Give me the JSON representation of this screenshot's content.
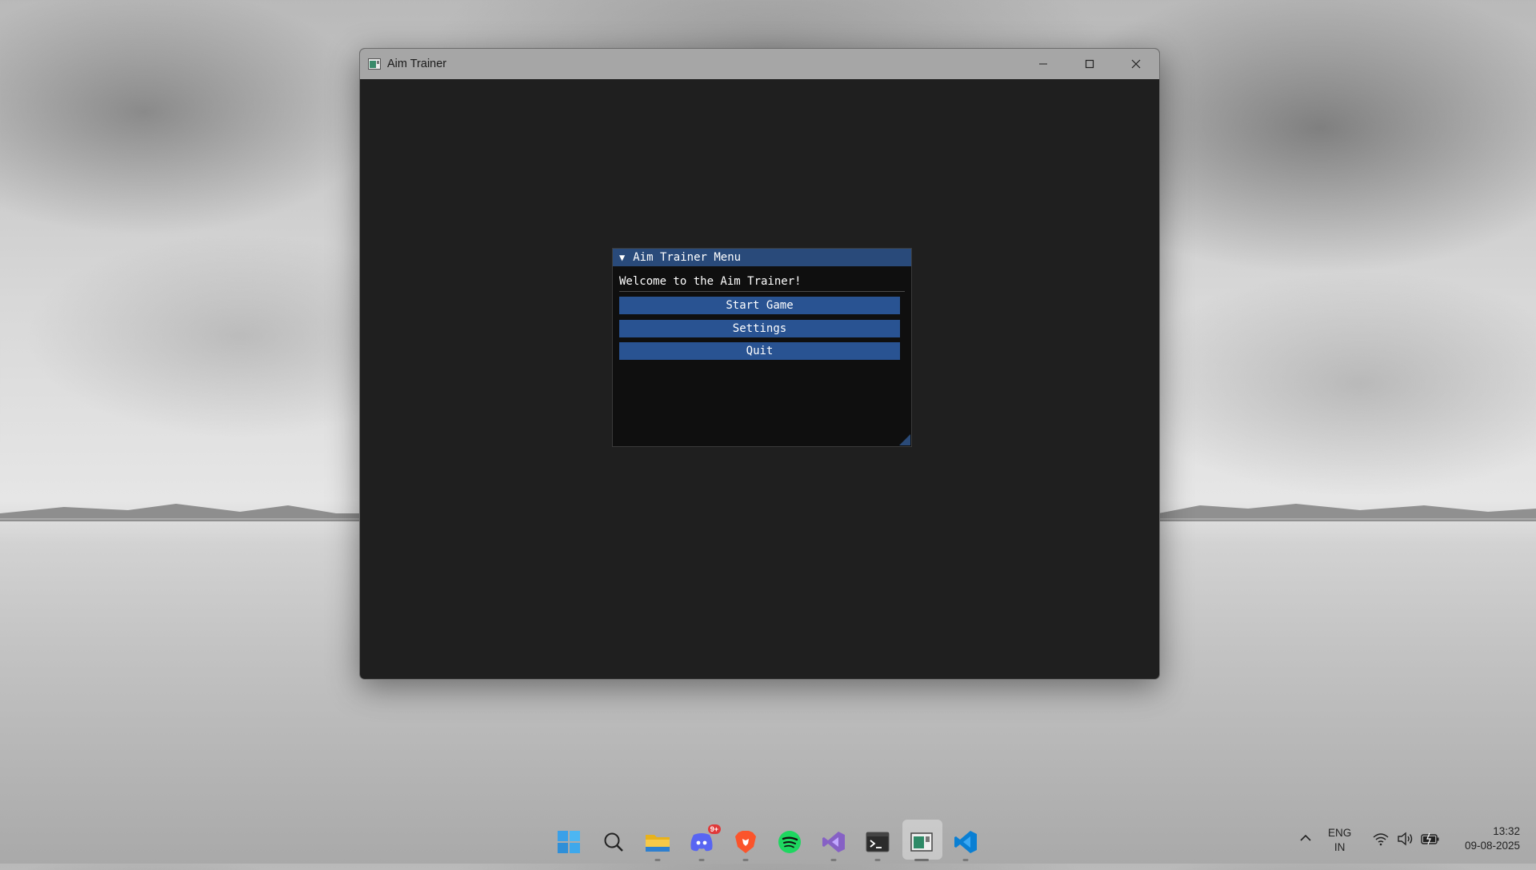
{
  "window": {
    "title": "Aim Trainer",
    "icons": [
      "app-icon",
      "minimize-icon",
      "maximize-icon",
      "close-icon"
    ]
  },
  "imgui": {
    "title": "Aim Trainer Menu",
    "welcome_text": "Welcome to the Aim Trainer!",
    "buttons": [
      "Start Game",
      "Settings",
      "Quit"
    ]
  },
  "taskbar": {
    "apps": [
      "windows-start-icon",
      "search-icon",
      "file-explorer-icon",
      "discord-icon",
      "brave-icon",
      "spotify-icon",
      "visual-studio-icon",
      "terminal-icon",
      "aim-trainer-icon",
      "vscode-icon"
    ],
    "discord_badge": "9+",
    "language": {
      "line1": "ENG",
      "line2": "IN"
    },
    "time": "13:32",
    "date": "09-08-2025"
  },
  "colors": {
    "imgui_title": "#294a7a",
    "imgui_button": "#295392",
    "window_bg": "#1f1f1f"
  }
}
